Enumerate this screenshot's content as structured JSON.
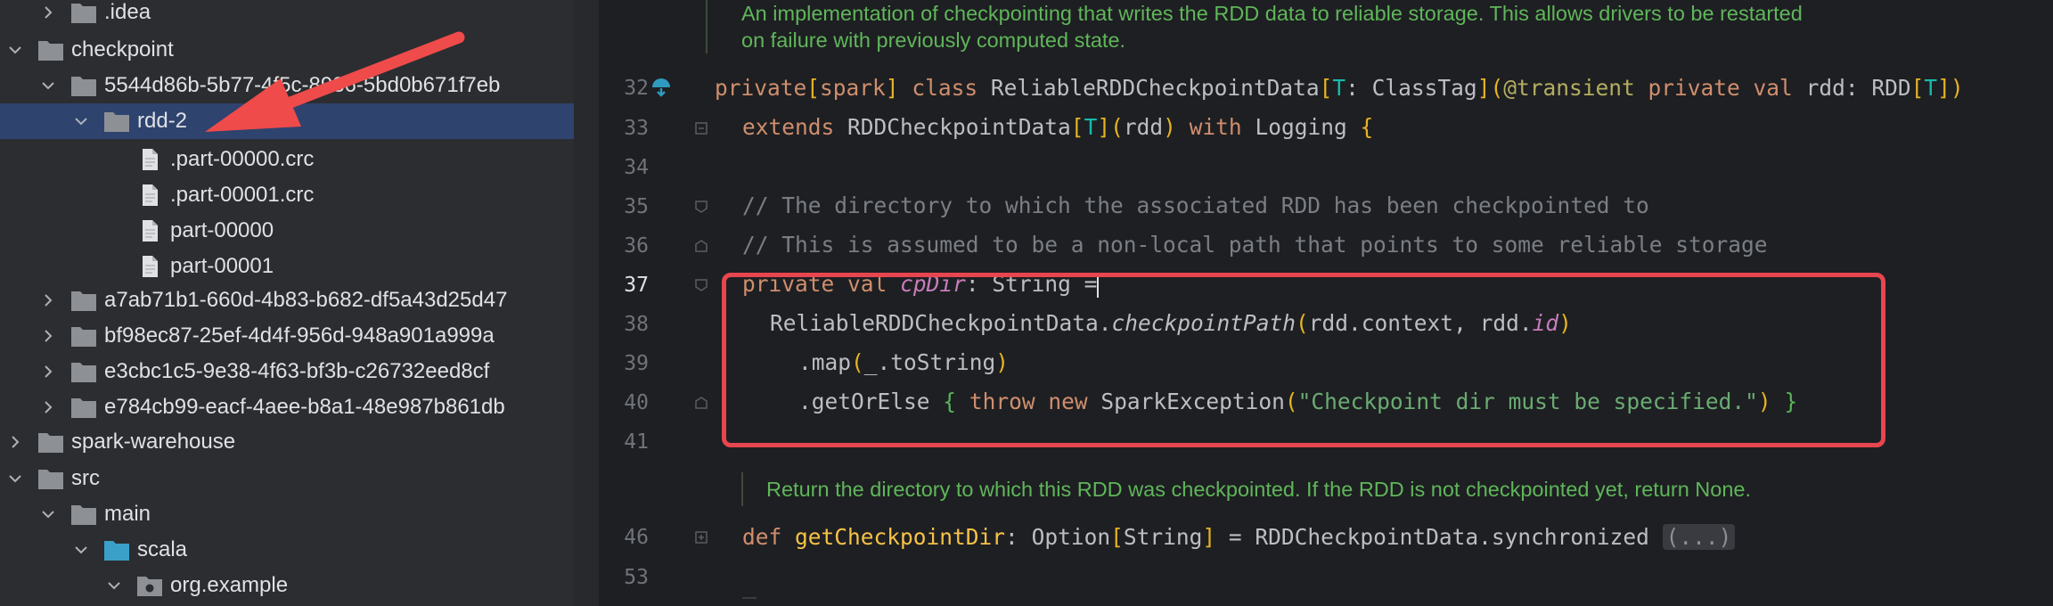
{
  "project_tree": {
    "items": [
      {
        "label": ".idea",
        "kind": "folder",
        "expanded": false,
        "selected": false
      },
      {
        "label": "checkpoint",
        "kind": "folder",
        "expanded": true,
        "selected": false
      },
      {
        "label": "5544d86b-5b77-4f5c-8986-5bd0b671f7eb",
        "kind": "folder",
        "expanded": true,
        "selected": false
      },
      {
        "label": "rdd-2",
        "kind": "folder",
        "expanded": true,
        "selected": true
      },
      {
        "label": ".part-00000.crc",
        "kind": "file",
        "selected": false
      },
      {
        "label": ".part-00001.crc",
        "kind": "file",
        "selected": false
      },
      {
        "label": "part-00000",
        "kind": "file",
        "selected": false
      },
      {
        "label": "part-00001",
        "kind": "file",
        "selected": false
      },
      {
        "label": "a7ab71b1-660d-4b83-b682-df5a43d25d47",
        "kind": "folder",
        "expanded": false,
        "selected": false
      },
      {
        "label": "bf98ec87-25ef-4d4f-956d-948a901a999a",
        "kind": "folder",
        "expanded": false,
        "selected": false
      },
      {
        "label": "e3cbc1c5-9e38-4f63-bf3b-c26732eed8cf",
        "kind": "folder",
        "expanded": false,
        "selected": false
      },
      {
        "label": "e784cb99-eacf-4aee-b8a1-48e987b861db",
        "kind": "folder",
        "expanded": false,
        "selected": false
      },
      {
        "label": "spark-warehouse",
        "kind": "folder",
        "expanded": false,
        "selected": false
      },
      {
        "label": "src",
        "kind": "folder",
        "expanded": true,
        "selected": false
      },
      {
        "label": "main",
        "kind": "folder",
        "expanded": true,
        "selected": false
      },
      {
        "label": "scala",
        "kind": "source-folder",
        "expanded": true,
        "selected": false
      },
      {
        "label": "org.example",
        "kind": "package",
        "expanded": true,
        "selected": false
      }
    ]
  },
  "editor": {
    "doc_comment_1": [
      "An implementation of checkpointing that writes the RDD data to reliable storage. This allows drivers to be restarted",
      "on failure with previously computed state."
    ],
    "doc_comment_2": "Return the directory to which this RDD was checkpointed. If the RDD is not checkpointed yet, return None.",
    "line_numbers": [
      "32",
      "33",
      "34",
      "35",
      "36",
      "37",
      "38",
      "39",
      "40",
      "41",
      "46",
      "53"
    ],
    "current_line": "37",
    "code": {
      "l32": {
        "private": "private",
        "spark": "spark",
        "class": "class",
        "name": "ReliableRDDCheckpointData",
        "tparam": "T",
        "classtag": "ClassTag",
        "annotation": "@transient",
        "private2": "private",
        "val": "val",
        "rdd": "rdd",
        "rddtype": "RDD",
        "tparam2": "T"
      },
      "l33": {
        "extends": "extends",
        "parent": "RDDCheckpointData",
        "tparam": "T",
        "rdd": "rdd",
        "with": "with",
        "logging": "Logging"
      },
      "l35": "// The directory to which the associated RDD has been checkpointed to",
      "l36": "// This is assumed to be a non-local path that points to some reliable storage",
      "l37": {
        "private": "private",
        "val": "val",
        "name": "cpDir",
        "type": "String"
      },
      "l38": {
        "obj": "ReliableRDDCheckpointData.",
        "method": "checkpointPath",
        "arg1": "rdd.context",
        "arg2a": "rdd.",
        "arg2b": "id"
      },
      "l39": {
        "method": ".map",
        "arg": "_.toString"
      },
      "l40": {
        "method": ".getOrElse",
        "throw": "throw",
        "new": "new",
        "exc": "SparkException",
        "msg": "\"Checkpoint dir must be specified.\""
      },
      "l46": {
        "def": "def",
        "name": "getCheckpointDir",
        "rettype": "Option",
        "tparam": "String",
        "rhs": "RDDCheckpointData.synchronized",
        "collapsed": "(...)"
      }
    }
  },
  "colors": {
    "selection": "#2e436e",
    "annotation_box": "#e8464f",
    "annotation_arrow": "#ef4b4b"
  }
}
